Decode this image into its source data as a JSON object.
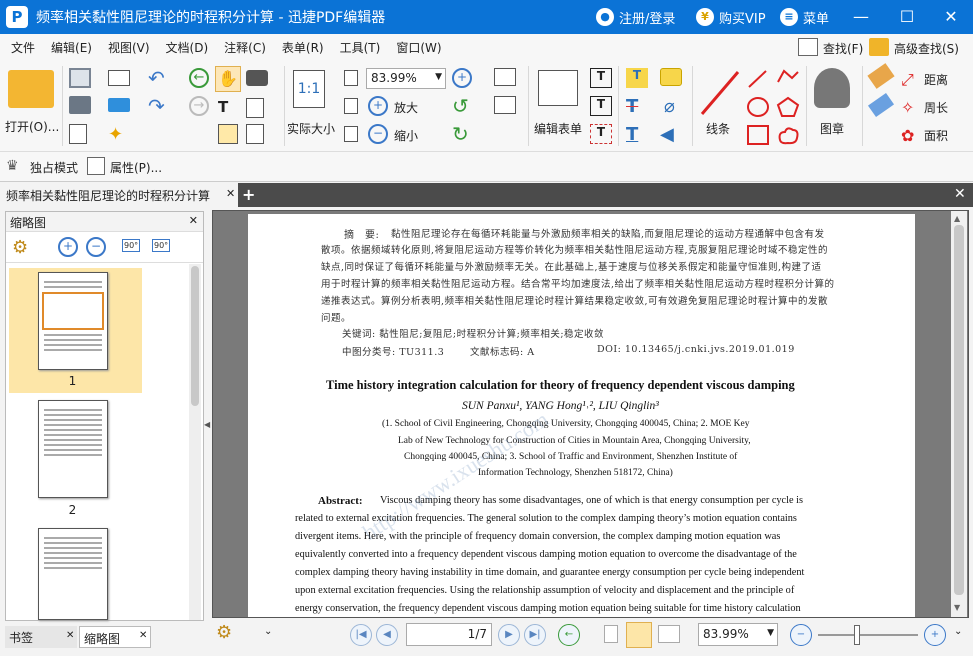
{
  "window": {
    "title": "频率相关黏性阻尼理论的时程积分计算 - 迅捷PDF编辑器",
    "login": "注册/登录",
    "vip": "购买VIP",
    "menu": "菜单"
  },
  "menubar": [
    "文件",
    "编辑(E)",
    "视图(V)",
    "文档(D)",
    "注释(C)",
    "表单(R)",
    "工具(T)",
    "窗口(W)"
  ],
  "menu_right": {
    "find": "查找(F)",
    "adv_find": "高级查找(S)"
  },
  "ribbon": {
    "open": "打开(O)...",
    "actual_size": "实际大小",
    "zoom_value": "83.99%",
    "zoom_in": "放大",
    "zoom_out": "缩小",
    "edit_form": "编辑表单",
    "line": "线条",
    "stamp": "图章",
    "distance": "距离",
    "perimeter": "周长",
    "area": "面积"
  },
  "toolbar2": {
    "exclusive": "独占模式",
    "properties": "属性(P)..."
  },
  "tab": {
    "label": "频率相关黏性阻尼理论的时程积分计算"
  },
  "sidepanel": {
    "title": "缩略图",
    "pages": [
      "1",
      "2"
    ],
    "rotate_left": "90°",
    "rotate_right": "90°"
  },
  "sidetabs": {
    "bookmarks": "书签",
    "thumbnails": "缩略图"
  },
  "document": {
    "abstract_cn_label": "摘　要:",
    "abstract_cn": [
      "黏性阻尼理论存在每循环耗能量与外激励频率相关的缺陷,而复阻尼理论的运动方程通解中包含有发",
      "散项。依据频域转化原则,将复阻尼运动方程等价转化为频率相关黏性阻尼运动方程,克服复阻尼理论时域不稳定性的",
      "缺点,同时保证了每循环耗能量与外激励频率无关。在此基础上,基于速度与位移关系假定和能量守恒准则,构建了适",
      "用于时程计算的频率相关黏性阻尼运动方程。结合常平均加速度法,给出了频率相关黏性阻尼运动方程时程积分计算的",
      "递推表达式。算例分析表明,频率相关黏性阻尼理论时程计算结果稳定收敛,可有效避免复阻尼理论时程计算中的发散",
      "问题。"
    ],
    "keywords_cn": "关键词: 黏性阻尼;复阻尼;时程积分计算;频率相关;稳定收敛",
    "class_no": "中图分类号: TU311.3",
    "doc_code": "文献标志码: A",
    "doi": "DOI: 10.13465/j.cnki.jvs.2019.01.019",
    "title_en": "Time history integration calculation for theory of frequency dependent viscous damping",
    "authors_en": "SUN Panxu¹, YANG Hong¹˒², LIU Qinglin³",
    "affil": [
      "(1. School of Civil Engineering, Chongqing University, Chongqing 400045, China; 2. MOE Key",
      "Lab of New Technology for Construction of Cities in Mountain Area, Chongqing University,",
      "Chongqing 400045, China; 3. School of Traffic and Environment, Shenzhen Institute of",
      "Information Technology, Shenzhen 518172, China)"
    ],
    "abstract_en_label": "Abstract:",
    "abstract_en": [
      "Viscous damping theory has some disadvantages, one of which is that energy consumption per cycle is",
      "related to external excitation frequencies. The general solution to the complex damping theory’s motion equation contains",
      "divergent items. Here, with the principle of frequency domain conversion, the complex damping motion equation was",
      "equivalently converted into a frequency dependent viscous damping motion equation to overcome the disadvantage of the",
      "complex damping theory having instability in time domain, and guarantee energy consumption per cycle being independent",
      "upon external excitation frequencies. Using the relationship assumption of velocity and displacement and the principle of",
      "energy conservation, the frequency dependent viscous damping motion equation being suitable for time history calculation"
    ],
    "watermark": "http://www.ixueshu.com"
  },
  "bottombar": {
    "page_current": "1",
    "page_total": "/7",
    "zoom": "83.99%"
  }
}
